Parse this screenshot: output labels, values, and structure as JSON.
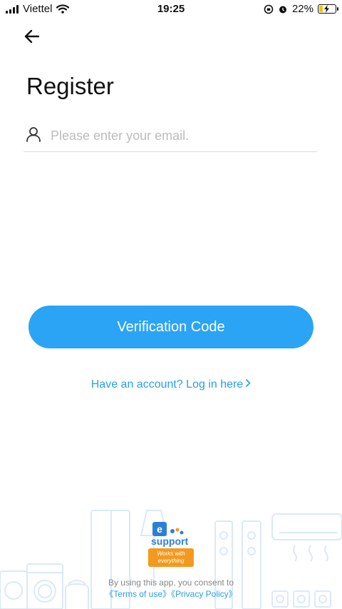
{
  "status_bar": {
    "carrier": "Viettel",
    "time": "19:25",
    "battery_percent": "22%",
    "battery_level": 0.22
  },
  "header": {
    "back_icon": "arrow-left-icon"
  },
  "page": {
    "title": "Register"
  },
  "email": {
    "icon": "user-icon",
    "placeholder": "Please enter your email.",
    "value": ""
  },
  "actions": {
    "verification_label": "Verification Code",
    "login_prompt": "Have an account? Log in here",
    "login_chevron": "chevron-right-icon"
  },
  "brand": {
    "logo_letter": "e",
    "logo_name": "support",
    "tagline_line1": "Works with",
    "tagline_line2": "everything"
  },
  "consent": {
    "text": "By using this app, you consent to",
    "terms_label": "《Terms of use》",
    "privacy_label": "《Privacy Policy》"
  },
  "colors": {
    "accent": "#2ba4f5",
    "link": "#2a9fe8",
    "brand_orange": "#f39a1e"
  }
}
